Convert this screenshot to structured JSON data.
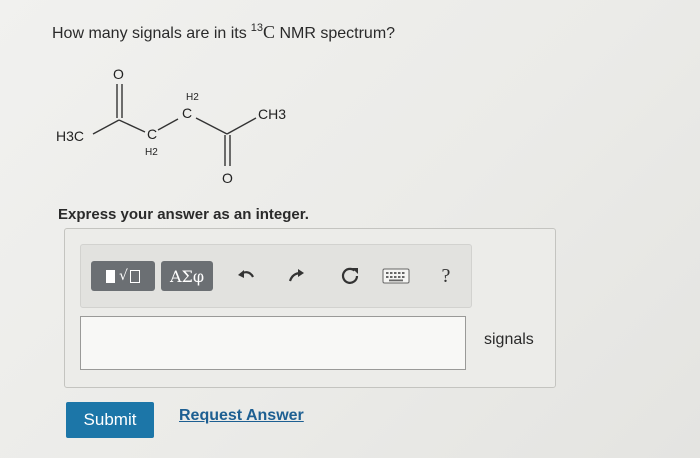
{
  "question": {
    "prefix": "How many signals are in its",
    "isotope_mass": "13",
    "isotope_symbol": "C",
    "suffix": "NMR spectrum?"
  },
  "molecule": {
    "atom_o_top": "O",
    "atom_h3c": "H3C",
    "atom_c_lower": "C",
    "atom_h2_lower": "H2",
    "atom_h2_upper": "H2",
    "atom_c_upper": "C",
    "atom_ch3": "CH3",
    "atom_o_bottom": "O"
  },
  "instruction": "Express your answer as an integer.",
  "toolbar": {
    "symbols_label": "ΑΣφ",
    "help_label": "?",
    "icons": [
      "templates-icon",
      "undo-icon",
      "redo-icon",
      "reset-icon",
      "keyboard-icon",
      "help-icon"
    ]
  },
  "answer": {
    "value": "",
    "units": "signals"
  },
  "actions": {
    "submit_label": "Submit",
    "request_label": "Request Answer"
  },
  "colors": {
    "submit_bg": "#1c76a8",
    "link": "#1d5f92",
    "toolbar_button": "#6b6f73"
  }
}
